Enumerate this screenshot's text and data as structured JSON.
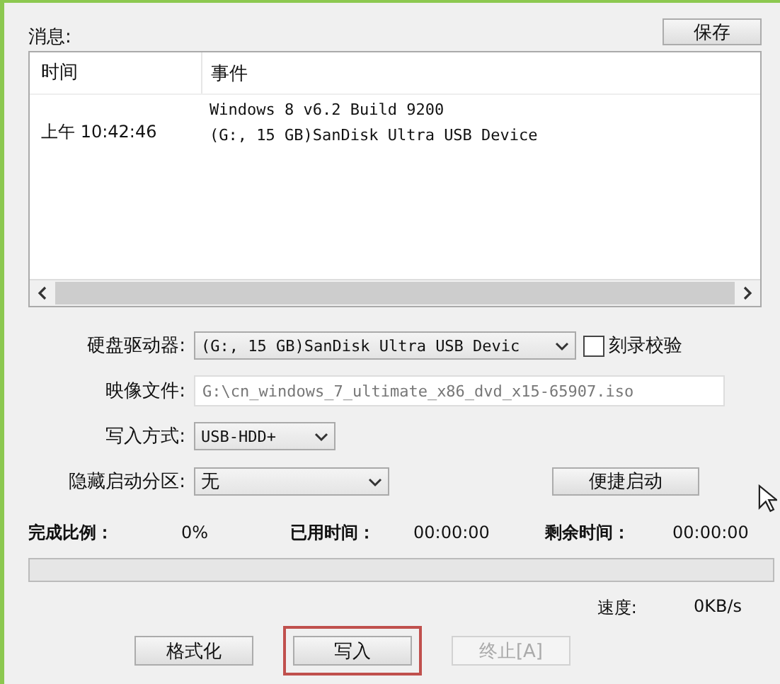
{
  "messages": {
    "label": "消息:",
    "save_button": "保存",
    "columns": [
      "时间",
      "事件"
    ],
    "rows": [
      {
        "time": "上午 10:42:46",
        "event_lines": [
          "Windows 8 v6.2 Build 9200",
          "(G:, 15 GB)SanDisk Ultra USB Device"
        ]
      }
    ]
  },
  "form": {
    "drive": {
      "label": "硬盘驱动器:",
      "value": "(G:, 15 GB)SanDisk Ultra USB Devic"
    },
    "verify": {
      "label": "刻录校验",
      "checked": false
    },
    "image": {
      "label": "映像文件:",
      "value": "G:\\cn_windows_7_ultimate_x86_dvd_x15-65907.iso"
    },
    "write_mode": {
      "label": "写入方式:",
      "value": "USB-HDD+"
    },
    "hidden_partition": {
      "label": "隐藏启动分区:",
      "value": "无"
    },
    "quick_boot_button": "便捷启动"
  },
  "progress": {
    "percent_label": "完成比例：",
    "percent": "0%",
    "elapsed_label": "已用时间：",
    "elapsed": "00:00:00",
    "remaining_label": "剩余时间：",
    "remaining": "00:00:00",
    "level": 0,
    "speed_label": "速度:",
    "speed": "0KB/s"
  },
  "buttons": [
    {
      "label": "格式化",
      "disabled": false,
      "highlighted": false
    },
    {
      "label": "写入",
      "disabled": false,
      "highlighted": true
    },
    {
      "label": "终止[A]",
      "disabled": true,
      "highlighted": false
    }
  ]
}
